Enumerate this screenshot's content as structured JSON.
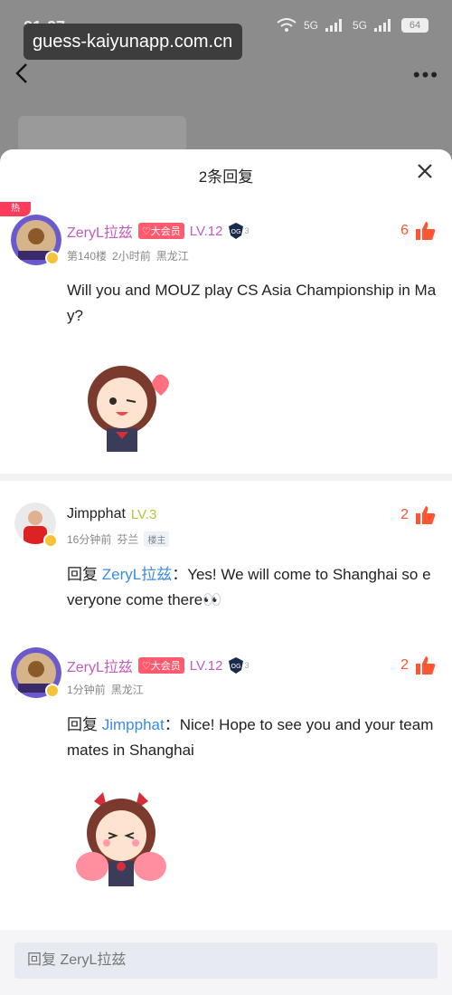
{
  "status": {
    "time": "21:27",
    "battery": "64",
    "net1": "5G",
    "net2": "5G"
  },
  "banner": {
    "url": "guess-kaiyunapp.com.cn"
  },
  "sheet": {
    "title": "2条回复",
    "hot_label": "热"
  },
  "comments": [
    {
      "user": "ZeryL拉兹",
      "vip_tag": "♡大会员",
      "level": "LV.12",
      "team_count": "3",
      "meta_floor": "第140楼",
      "meta_time": "2小时前",
      "meta_location": "黑龙江",
      "likes": "6",
      "text": "Will you and MOUZ play CS Asia Championship in May?"
    },
    {
      "user": "Jimpphat",
      "level": "LV.3",
      "meta_time": "16分钟前",
      "meta_location": "芬兰",
      "host_tag": "楼主",
      "likes": "2",
      "reply_prefix": "回复 ",
      "reply_target": "ZeryL拉兹",
      "reply_colon": "：",
      "text": "Yes! We will come to Shanghai so everyone come there👀"
    },
    {
      "user": "ZeryL拉兹",
      "vip_tag": "♡大会员",
      "level": "LV.12",
      "team_count": "3",
      "meta_time": "1分钟前",
      "meta_location": "黑龙江",
      "likes": "2",
      "reply_prefix": "回复 ",
      "reply_target": "Jimpphat",
      "reply_colon": "：",
      "text": "Nice! Hope to see you and your teammates in Shanghai"
    }
  ],
  "reply_input": {
    "placeholder": "回复 ZeryL拉兹"
  },
  "colors": {
    "accent_red": "#ff5533",
    "vip_name": "#c45cc0",
    "link_blue": "#3b8be0"
  }
}
